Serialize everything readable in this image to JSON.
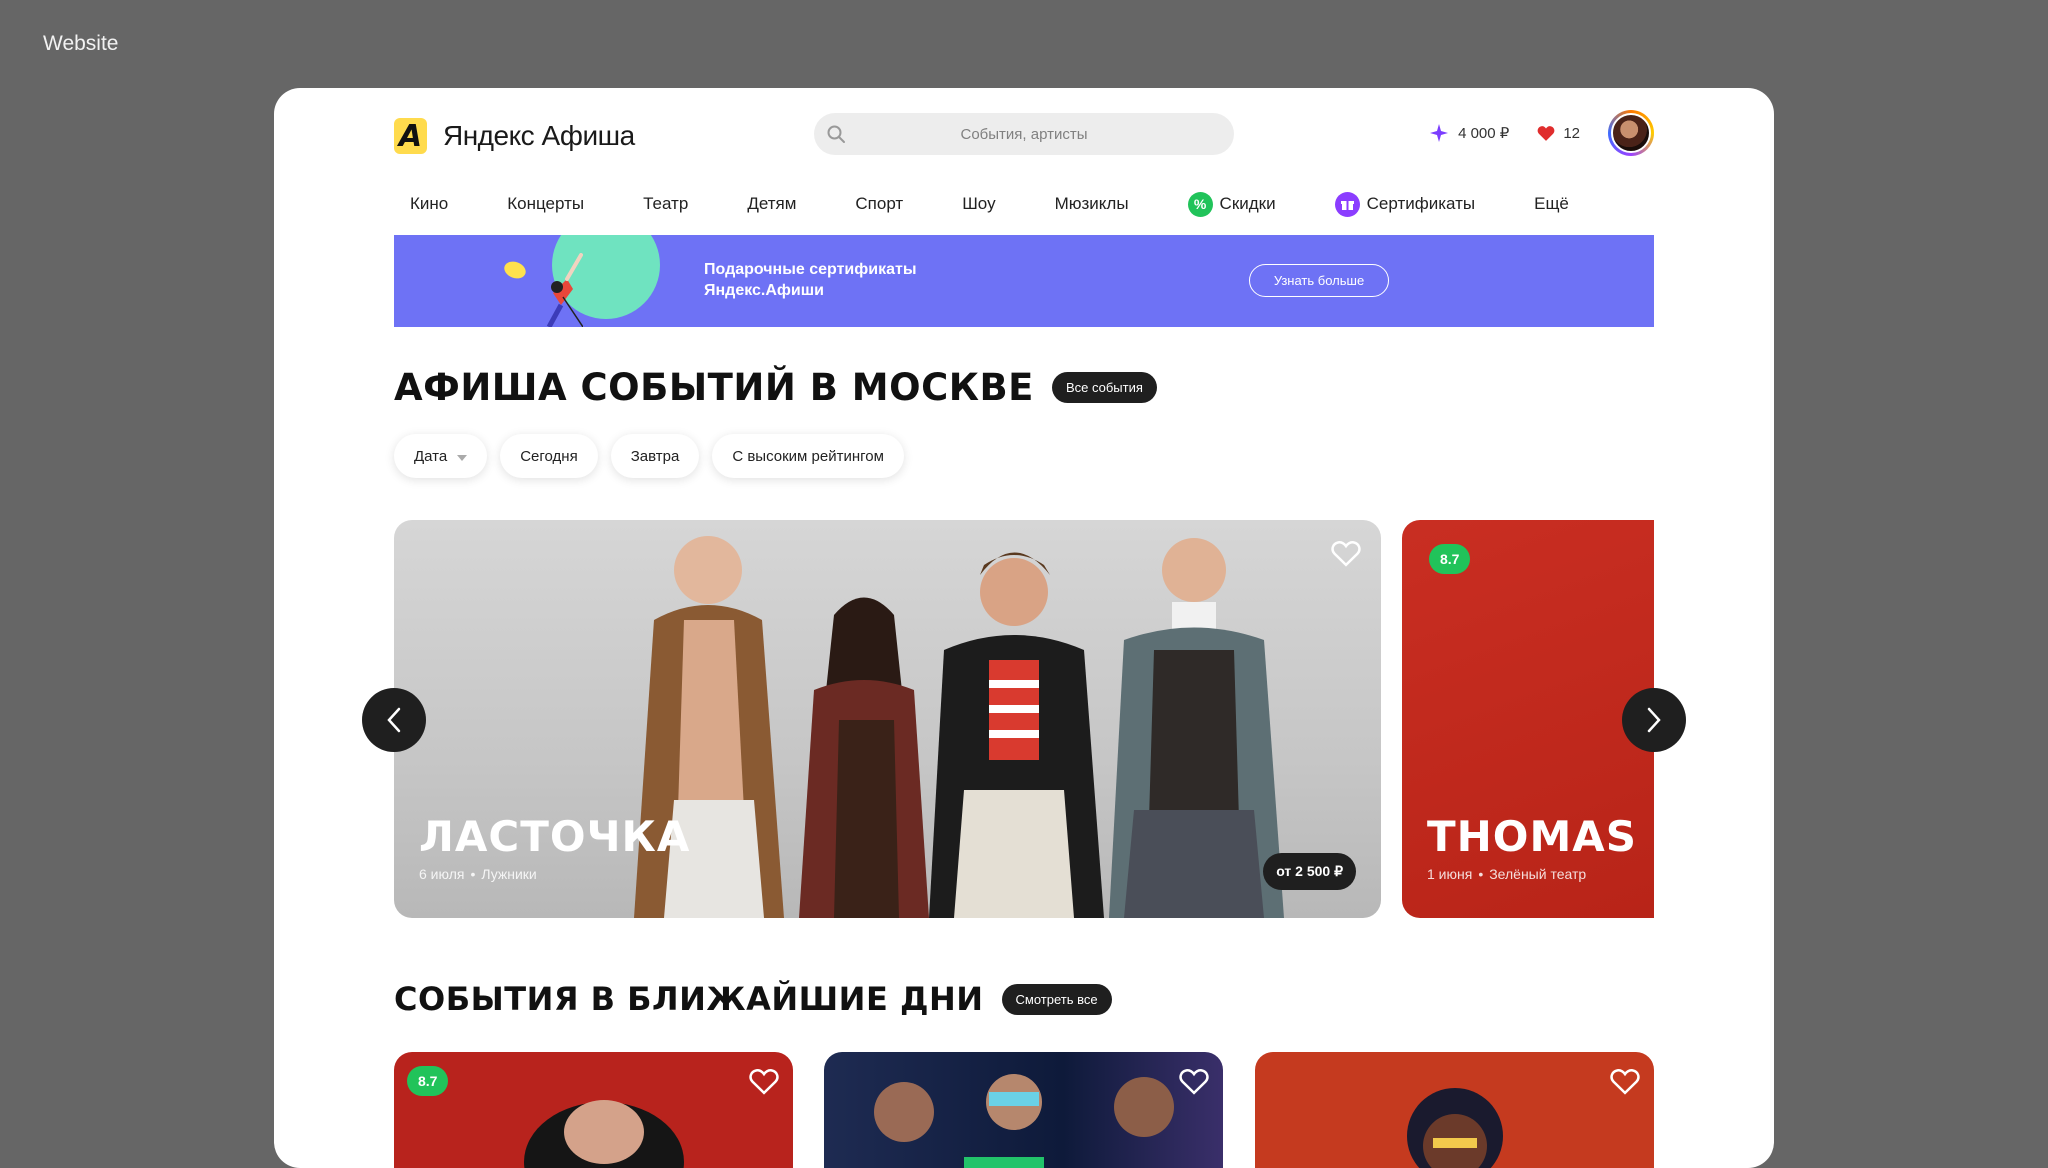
{
  "canvas_label": "Website",
  "header": {
    "logo_text": "Яндекс Афиша",
    "search_placeholder": "События, артисты",
    "points": "4 000 ₽",
    "likes_count": "12"
  },
  "nav": [
    {
      "label": "Кино"
    },
    {
      "label": "Концерты"
    },
    {
      "label": "Театр"
    },
    {
      "label": "Детям"
    },
    {
      "label": "Спорт"
    },
    {
      "label": "Шоу"
    },
    {
      "label": "Мюзиклы"
    },
    {
      "label": "Скидки",
      "badge": "%"
    },
    {
      "label": "Сертификаты",
      "badge": "gift"
    },
    {
      "label": "Ещё"
    }
  ],
  "banner": {
    "title": "Подарочные сертификаты Яндекс.Афиши",
    "button": "Узнать больше"
  },
  "section_main": {
    "title": "АФИША СОБЫТИЙ В МОСКВЕ",
    "all_button": "Все события"
  },
  "filters": [
    "Дата",
    "Сегодня",
    "Завтра",
    "С высоким рейтингом"
  ],
  "hero_cards": [
    {
      "title": "ЛАСТОЧКА",
      "date": "6 июля",
      "place": "Лужники",
      "price": "от 2 500 ₽"
    },
    {
      "title": "THOMAS M",
      "date": "1 июня",
      "place": "Зелёный театр",
      "rating": "8.7"
    }
  ],
  "section_upcoming": {
    "title": "СОБЫТИЯ В БЛИЖАЙШИЕ ДНИ",
    "all_button": "Смотреть все"
  },
  "upcoming_cards": [
    {
      "rating": "8.7",
      "color": "#b8231d"
    },
    {
      "color": "#0e1a3a"
    },
    {
      "color": "#c53a1f"
    }
  ],
  "colors": {
    "accent_yellow": "#ffdb4d",
    "banner_violet": "#6e72f5",
    "rating_green": "#21c35a",
    "like_red": "#e02d2d"
  }
}
